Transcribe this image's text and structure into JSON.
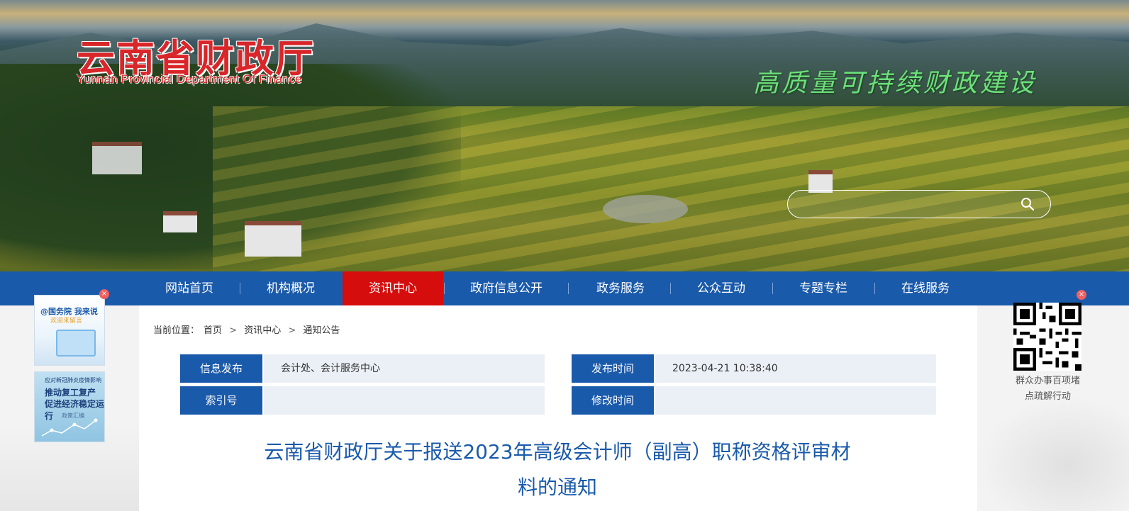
{
  "header": {
    "logo_cn": "云南省财政厅",
    "logo_en": "Yunnan Provincial Department Of Finance",
    "slogan": "高质量可持续财政建设"
  },
  "search": {
    "placeholder": "",
    "icon": "search-icon"
  },
  "nav": {
    "items": [
      {
        "label": "网站首页"
      },
      {
        "label": "机构概况"
      },
      {
        "label": "资讯中心",
        "active": true
      },
      {
        "label": "政府信息公开"
      },
      {
        "label": "政务服务"
      },
      {
        "label": "公众互动"
      },
      {
        "label": "专题专栏"
      },
      {
        "label": "在线服务"
      }
    ],
    "active_color": "#d50d0d",
    "bar_color": "#1a5aab"
  },
  "left_float": {
    "ad1": {
      "line1": "@国务院 我来说",
      "line2": "欢迎来留言"
    },
    "ad2": {
      "line1": "应对新冠肺炎疫情影响",
      "line2": "推动复工复产",
      "line3": "促进经济稳定运行",
      "line4": "政策汇编"
    },
    "close": "×"
  },
  "right_float": {
    "caption_line1": "群众办事百项堵",
    "caption_line2": "点疏解行动",
    "close": "×"
  },
  "breadcrumb": {
    "prefix": "当前位置：",
    "items": [
      "首页",
      "资讯中心",
      "通知公告"
    ],
    "separator": ">"
  },
  "info": {
    "publisher_label": "信息发布",
    "publisher_value": "会计处、会计服务中心",
    "time_label": "发布时间",
    "time_value": "2023-04-21 10:38:40",
    "index_label": "索引号",
    "index_value": "",
    "modified_label": "修改时间",
    "modified_value": ""
  },
  "article": {
    "title_line1": "云南省财政厅关于报送2023年高级会计师（副高）职称资格评审材",
    "title_line2": "料的通知"
  }
}
